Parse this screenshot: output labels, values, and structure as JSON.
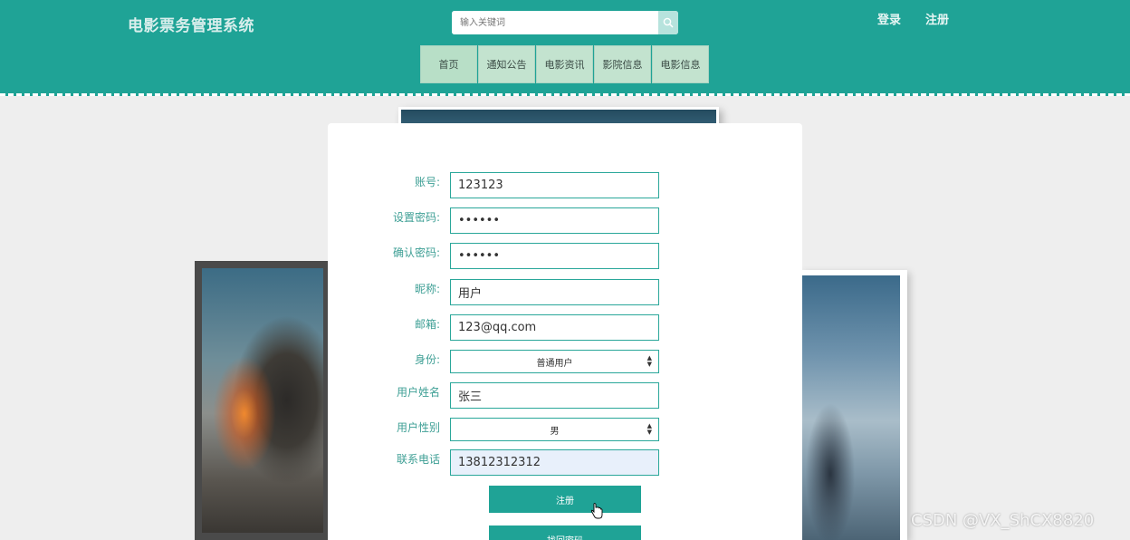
{
  "header": {
    "title": "电影票务管理系统",
    "search": {
      "placeholder": "输入关键词",
      "value": ""
    },
    "login_label": "登录",
    "register_label": "注册"
  },
  "nav": [
    {
      "label": "首页"
    },
    {
      "label": "通知公告"
    },
    {
      "label": "电影资讯"
    },
    {
      "label": "影院信息"
    },
    {
      "label": "电影信息"
    }
  ],
  "form": {
    "account": {
      "label": "账号:",
      "value": "123123"
    },
    "password": {
      "label": "设置密码:",
      "value": "••••••"
    },
    "confirm_password": {
      "label": "确认密码:",
      "value": "••••••"
    },
    "nickname": {
      "label": "昵称:",
      "value": "用户"
    },
    "email": {
      "label": "邮箱:",
      "value": "123@qq.com"
    },
    "identity": {
      "label": "身份:",
      "selected": "普通用户"
    },
    "real_name": {
      "label": "用户姓名",
      "value": "张三"
    },
    "gender": {
      "label": "用户性别",
      "selected": "男"
    },
    "phone": {
      "label": "联系电话",
      "value": "13812312312"
    },
    "register_button": "注册",
    "retrieve_button": "找回密码"
  },
  "watermark": "CSDN @VX_ShCX8820",
  "colors": {
    "primary": "#1fa396",
    "nav_bg": "#c3e3cf",
    "label": "#3e9f95"
  }
}
